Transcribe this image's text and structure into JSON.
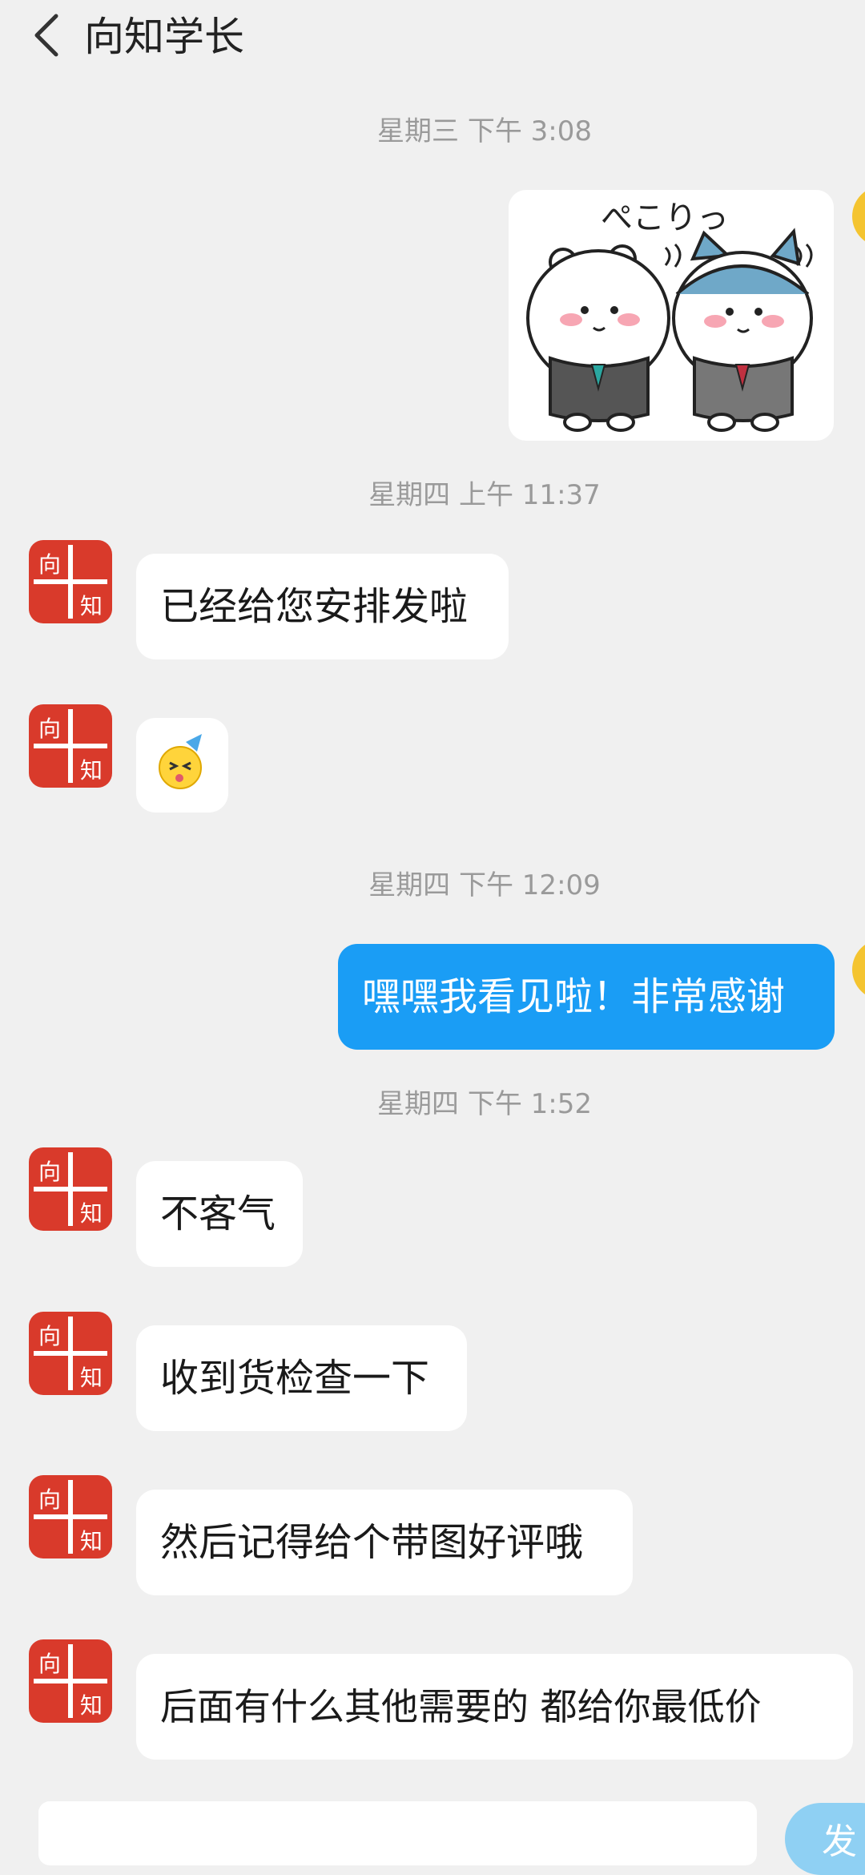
{
  "header": {
    "title": "向知学长",
    "back_icon": "chevron-left-icon"
  },
  "messages": [
    {
      "timestamp": "星期三 下午 3:08"
    },
    {
      "sticker": "two-bears-bowing-sticker",
      "sticker_text": "ぺこりっ",
      "from": "me"
    },
    {
      "timestamp": "星期四 上午 11:37"
    },
    {
      "from": "other",
      "text": "已经给您安排发啦"
    },
    {
      "from": "other",
      "emoji": "party-face-emoji"
    },
    {
      "timestamp": "星期四 下午 12:09"
    },
    {
      "from": "me",
      "text": "嘿嘿我看见啦！非常感谢"
    },
    {
      "timestamp": "星期四 下午 1:52"
    },
    {
      "from": "other",
      "text": "不客气"
    },
    {
      "from": "other",
      "text": "收到货检查一下"
    },
    {
      "from": "other",
      "text": "然后记得给个带图好评哦"
    },
    {
      "from": "other",
      "text": "后面有什么其他需要的 都给你最低价"
    }
  ],
  "avatar": {
    "glyph_top": "向",
    "glyph_bottom": "知",
    "color": "#d93a2b"
  },
  "colors": {
    "accent": "#1a9df5",
    "background": "#f0f0f0",
    "bubble": "#ffffff"
  },
  "input": {
    "value": "",
    "send_label": "发"
  }
}
